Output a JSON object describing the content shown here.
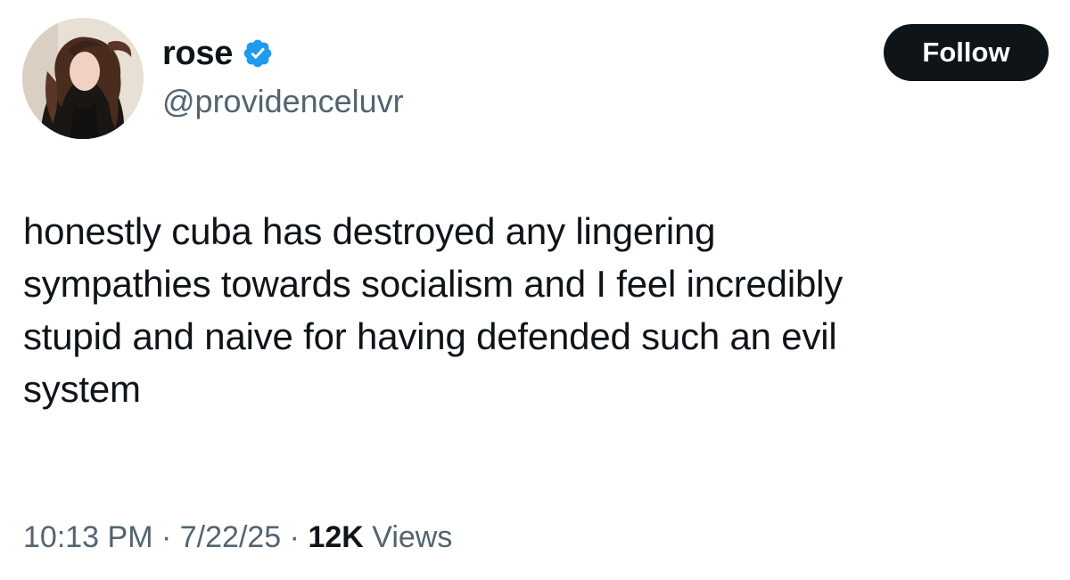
{
  "user": {
    "display_name": "rose",
    "handle": "@providenceluvr",
    "verified": true,
    "verified_icon": "verified-badge-icon",
    "badge_color": "#1d9bf0"
  },
  "follow_button": {
    "label": "Follow"
  },
  "tweet": {
    "text": "honestly cuba has destroyed any lingering\nsympathies towards socialism and I feel incredibly\nstupid and naive for having defended such an evil\nsystem"
  },
  "meta": {
    "time": "10:13 PM",
    "separator": "·",
    "date": "7/22/25",
    "views_count": "12K",
    "views_label": "Views"
  },
  "colors": {
    "text_primary": "#0f1419",
    "text_secondary": "#536471",
    "button_bg": "#0f1419",
    "button_text": "#ffffff"
  }
}
